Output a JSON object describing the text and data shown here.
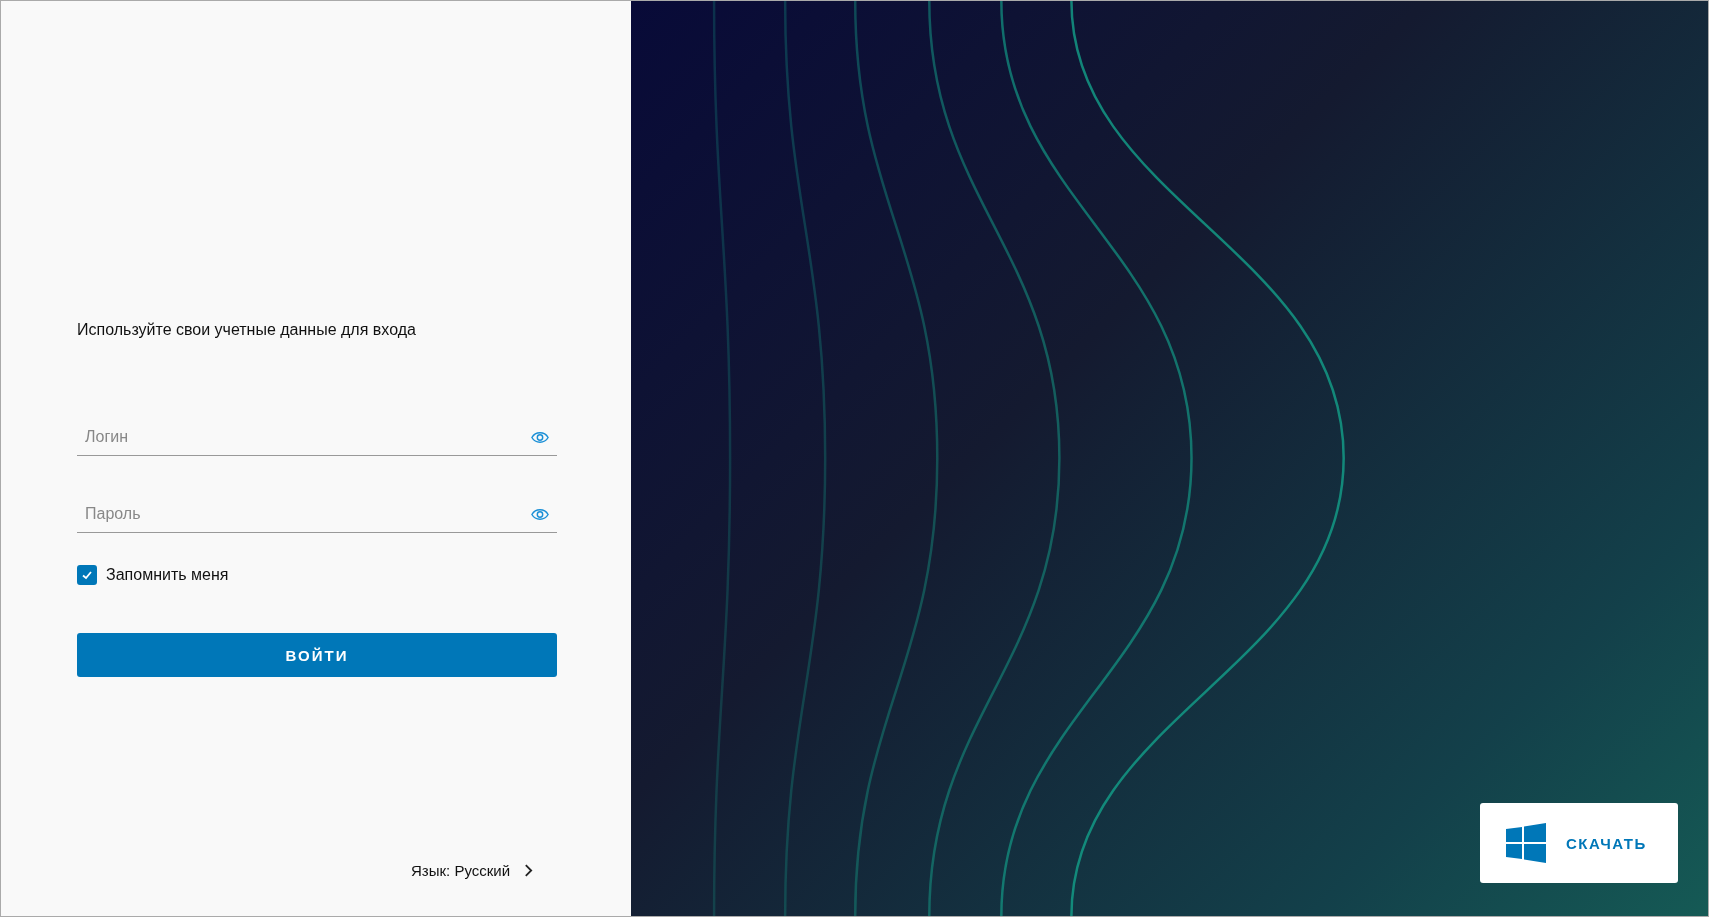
{
  "login_form": {
    "heading": "Используйте свои учетные данные для входа",
    "fields": [
      {
        "placeholder": "Логин"
      },
      {
        "placeholder": "Пароль"
      }
    ],
    "remember": {
      "label": "Запомнить меня",
      "checked": true
    },
    "submit": "ВОЙТИ",
    "language": "Язык: Русский"
  },
  "download": {
    "label": "СКАЧАТЬ"
  }
}
